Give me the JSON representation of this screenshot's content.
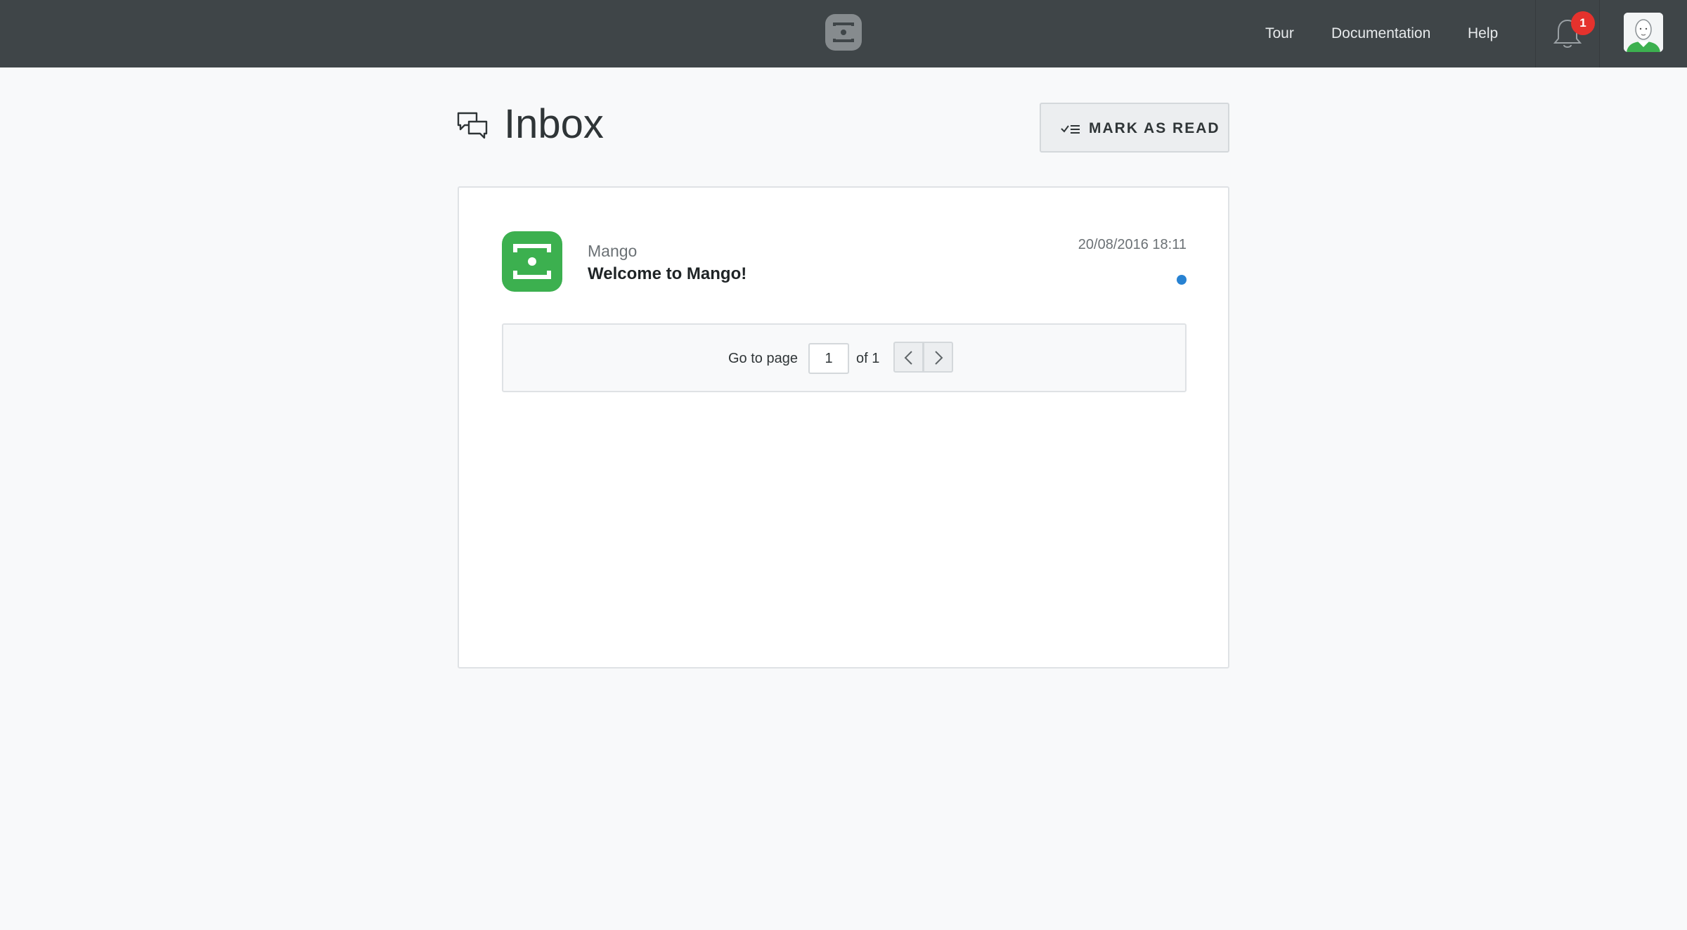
{
  "nav": {
    "tour": "Tour",
    "documentation": "Documentation",
    "help": "Help",
    "notification_count": "1",
    "icons": [
      "logo-icon",
      "bell-icon",
      "user-avatar"
    ]
  },
  "page": {
    "title": "Inbox",
    "mark_as_read_label": "MARK AS READ"
  },
  "messages": [
    {
      "sender": "Mango",
      "subject": "Welcome to Mango!",
      "timestamp": "20/08/2016 18:11",
      "unread": true
    }
  ],
  "pagination": {
    "label": "Go to page",
    "current_page": "1",
    "of_label": "of 1"
  },
  "colors": {
    "topbar": "#3f4548",
    "brand_green": "#3cb04f",
    "badge_red": "#e5322d",
    "unread_blue": "#2782d2"
  }
}
